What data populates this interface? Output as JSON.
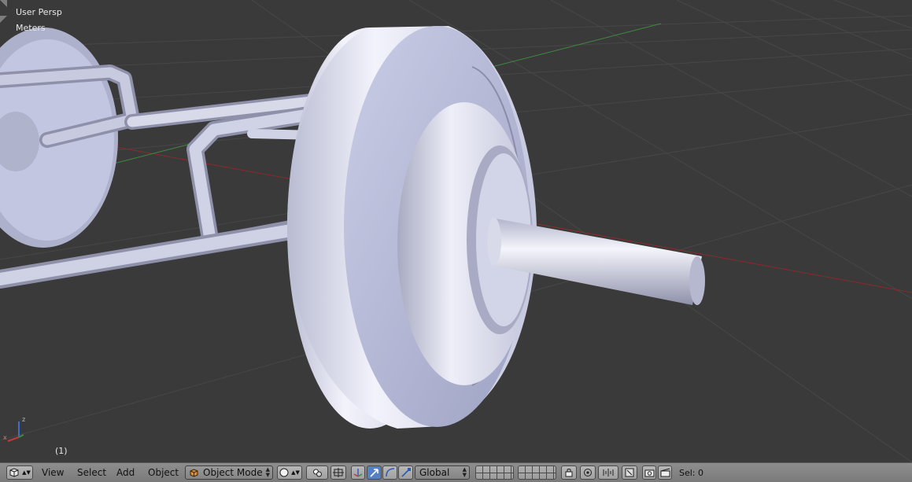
{
  "viewport": {
    "view_name": "User Persp",
    "units": "Meters",
    "frame": "(1)",
    "axes": {
      "x": "x",
      "z": "z"
    }
  },
  "header": {
    "editor_type_icon": "3d-view-icon",
    "menus": [
      "View",
      "Select",
      "Add",
      "Object"
    ],
    "mode": {
      "icon": "object-mode-cube-icon",
      "label": "Object Mode"
    },
    "shading": {
      "icon": "solid-shading-sphere-icon"
    },
    "pivot": {
      "icon": "pivot-point-icon"
    },
    "manipulator_icons": [
      "manipulator-toggle-icon",
      "translate-icon",
      "rotate-icon",
      "scale-icon"
    ],
    "orientation": "Global",
    "status": "Sel: 0"
  },
  "colors": {
    "viewport_bg": "#3a3a3a",
    "header_bg": "#8a8a8a",
    "grid": "#474747",
    "x_axis": "#8c2a2a",
    "y_axis": "#3f8a3f",
    "mesh": "#c8cbe4",
    "active_button": "#5680c2"
  }
}
